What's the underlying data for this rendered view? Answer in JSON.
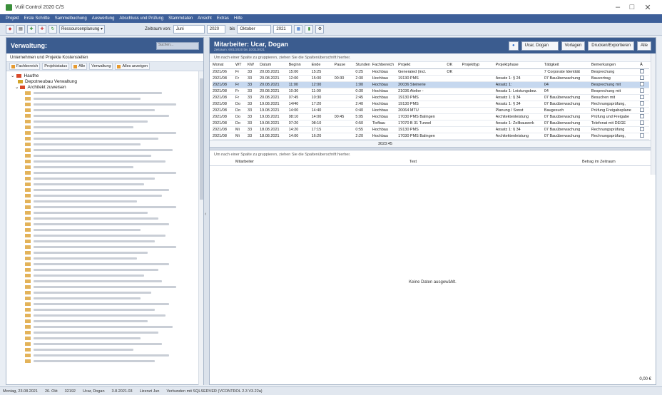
{
  "window": {
    "title": "Vulil Control 2020 C/S",
    "minimize": "–",
    "maximize": "□",
    "close": "✕"
  },
  "menu": [
    "Projekt",
    "Erste Schritte",
    "Sammelbuchung",
    "Auswertung",
    "Abschluss und Prüfung",
    "Stammdaten",
    "Ansicht",
    "Extras",
    "Hilfe"
  ],
  "toolbar": {
    "ressource_label": "Ressourcenplanung ▾",
    "zeitraum_label": "Zeitraum von:",
    "from_month": "Juni",
    "from_year": "2020",
    "to_label": "bis",
    "to_month": "Oktober",
    "to_year": "2021"
  },
  "left": {
    "title": "Verwaltung:",
    "search_placeholder": "Suchen...",
    "subheader": "Unternehmen und Projekte   Kostenstellen",
    "filters": [
      "Fachbereich",
      "Projektstatus",
      "Alle",
      "Verwaltung",
      "Alles anzeigen"
    ],
    "tree_root": "Hauthe",
    "tree_children": [
      "Depotneubau Verwaltung",
      "Architekt zuweisen"
    ]
  },
  "right": {
    "title": "Mitarbeiter: Ucar, Dogan",
    "subtitle": "Zeitraum: 6/01/2020 bis 10/31/2021",
    "user_select": "Ucar, Dogan",
    "buttons": [
      "Vorlagen",
      "Drucken/Exportieren",
      "Alle"
    ],
    "group_hint": "Um nach einer Spalte zu gruppieren, ziehen Sie die Spaltenüberschrift hierher.",
    "columns": [
      "Monat",
      "WT",
      "KW",
      "Datum",
      "Beginn",
      "Ende",
      "Pause",
      "Stunden",
      "Fachbereich",
      "Projekt",
      "OK",
      "Projekttyp",
      "Projektphase",
      "Tätigkeit",
      "Bemerkungen",
      "Ä"
    ],
    "rows": [
      [
        "2021/06",
        "Fr",
        "33",
        "20.08.2021",
        "15:00",
        "15:25",
        "",
        "0:25",
        "Hochbau",
        "Generated (incl.",
        "OK",
        "",
        "",
        "7 Corporate Identität",
        "Besprechung"
      ],
      [
        "2021/08",
        "Fr",
        "33",
        "20.08.2021",
        "12:00",
        "15:00",
        "00:30",
        "2:30",
        "Hochbau",
        "19130 PMS",
        "",
        "",
        "Ansatz 1: § 24",
        "07 Bauüberwachung",
        "Bauvortrag"
      ],
      [
        "2021/08",
        "Fr",
        "33",
        "20.08.2021",
        "11:00",
        "12:00",
        "",
        "1:00",
        "Hochbau",
        "20036 Steinerie",
        "",
        "",
        "Ansatz 1:",
        "04",
        "Besprechung mit"
      ],
      [
        "2021/08",
        "Fr",
        "33",
        "20.08.2021",
        "10:30",
        "11:00",
        "",
        "0:30",
        "Hochbau",
        "21036 Atelier -",
        "",
        "",
        "Ansatz 1: Leistungsbez.",
        "04",
        "Besprechung mit"
      ],
      [
        "2021/08",
        "Fr",
        "33",
        "20.08.2021",
        "07:45",
        "10:30",
        "",
        "2:45",
        "Hochbau",
        "19130 PMS",
        "",
        "",
        "Ansatz 1: § 34",
        "07 Bauüberwachung",
        "Besuchen mit"
      ],
      [
        "2021/08",
        "Do",
        "33",
        "19.08.2021",
        "14/40",
        "17:20",
        "",
        "2:40",
        "Hochbau",
        "19130 PMS",
        "",
        "",
        "Ansatz 1: § 34",
        "07 Bauüberwachung",
        "Rechnungsprüfung,"
      ],
      [
        "2021/08",
        "Do",
        "33",
        "19.08.2021",
        "14:00",
        "14:40",
        "",
        "0:40",
        "Hochbau",
        "20064 MTU",
        "",
        "",
        "Planung / Sonst",
        "Baugesuch",
        "Prüfung Freigabeplane"
      ],
      [
        "2021/08",
        "Do",
        "33",
        "19.08.2021",
        "08:10",
        "14:00",
        "00:45",
        "5:05",
        "Hochbau",
        "17030 PMS Balingen",
        "",
        "",
        "Architektenleistung",
        "07 Bauüberwachung",
        "Prüfung und Freigabe"
      ],
      [
        "2021/08",
        "Do",
        "33",
        "19.08.2021",
        "07:20",
        "08:10",
        "",
        "0:50",
        "Tiefbau",
        "17070 B 31 Tunnel",
        "",
        "",
        "Ansatz 1: Zollbauwerk",
        "07 Bauüberwachung",
        "Telefonat mit DEGE"
      ],
      [
        "2021/08",
        "Mi",
        "33",
        "18.08.2021",
        "14:20",
        "17:15",
        "",
        "0:55",
        "Hochbau",
        "19130 PMS",
        "",
        "",
        "Ansatz 1: § 34",
        "07 Bauüberwachung",
        "Rechnungsprüfung"
      ],
      [
        "2021/08",
        "Mi",
        "33",
        "18.08.2021",
        "14:00",
        "16:20",
        "",
        "2:20",
        "Hochbau",
        "17030 PMS Balingen",
        "",
        "",
        "Architektenleistung",
        "07 Bauüberwachung",
        "Rechnungsprüfung,"
      ]
    ],
    "sum": "3023:45",
    "bottom_group_hint": "Um nach einer Spalte zu gruppieren, ziehen Sie die Spaltenüberschrift hierher.",
    "bottom_columns": [
      "Mitarbeiter",
      "Text",
      "Betrag im Zeitraum"
    ],
    "no_data": "Keine Daten ausgewählt.",
    "bottom_total": "0,00 €"
  },
  "status": [
    "Montag, 23.08.2021",
    "26. Okt",
    "32192",
    "Ucar, Dogan",
    "3.8.2021.03",
    "Lizenzt Jun",
    "Verbunden mit SQLSERVER (VCONTROL 2.3 V3.22a)"
  ]
}
